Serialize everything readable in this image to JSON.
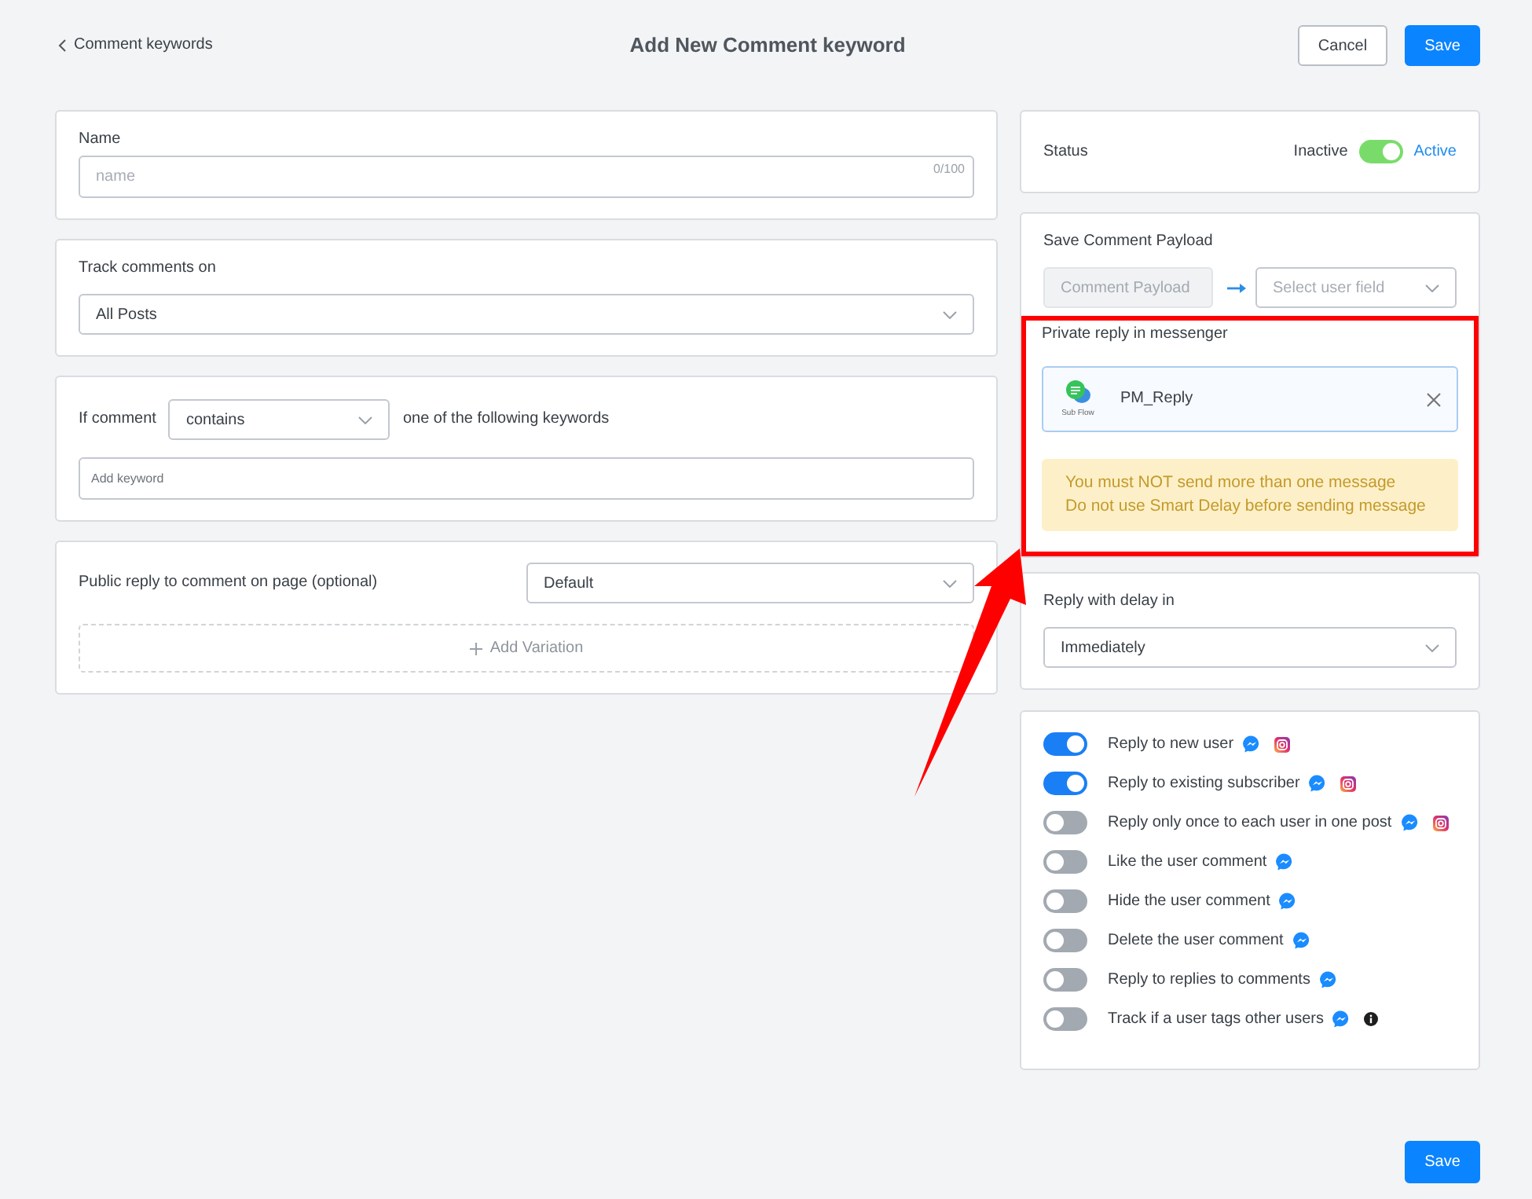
{
  "header": {
    "back_link": "Comment keywords",
    "title": "Add New Comment keyword",
    "buttons": [
      {
        "label": "Cancel",
        "kind": "secondary"
      },
      {
        "label": "Save",
        "kind": "primary"
      }
    ]
  },
  "name_card": {
    "label": "Name",
    "placeholder": "name",
    "counter": "0/100"
  },
  "track_card": {
    "label": "Track comments on",
    "value": "All Posts"
  },
  "keyword_card": {
    "prefix": "If comment",
    "match_value": "contains",
    "suffix": "one of the following keywords",
    "placeholder": "Add keyword"
  },
  "public_reply_card": {
    "label": "Public reply to comment on page (optional)",
    "value": "Default",
    "add_button": "Add Variation"
  },
  "status_card": {
    "label": "Status",
    "off_label": "Inactive",
    "on_label": "Active",
    "on": true
  },
  "payload_card": {
    "label": "Save Comment Payload",
    "source": {
      "placeholder": "Comment Payload",
      "disabled": true
    },
    "target": {
      "placeholder": "Select user field"
    },
    "private_reply": {
      "highlighted": true,
      "label": "Private reply in messenger",
      "flow": {
        "badge": "Sub Flow",
        "name": "PM_Reply"
      },
      "warnings": [
        "You must NOT send more than one message",
        "Do not use Smart Delay before sending message"
      ]
    }
  },
  "delay_card": {
    "label": "Reply with delay in",
    "value": "Immediately"
  },
  "options": [
    {
      "label": "Reply to new user",
      "on": true,
      "icons": [
        {
          "kind": "messenger"
        },
        {
          "kind": "instagram"
        }
      ]
    },
    {
      "label": "Reply to existing subscriber",
      "on": true,
      "icons": [
        {
          "kind": "messenger"
        },
        {
          "kind": "instagram"
        }
      ]
    },
    {
      "label": "Reply only once to each user in one post",
      "on": false,
      "icons": [
        {
          "kind": "messenger"
        },
        {
          "kind": "instagram"
        }
      ]
    },
    {
      "label": "Like the user comment",
      "on": false,
      "icons": [
        {
          "kind": "messenger"
        }
      ]
    },
    {
      "label": "Hide the user comment",
      "on": false,
      "icons": [
        {
          "kind": "messenger"
        }
      ]
    },
    {
      "label": "Delete the user comment",
      "on": false,
      "icons": [
        {
          "kind": "messenger"
        }
      ]
    },
    {
      "label": "Reply to replies to comments",
      "on": false,
      "icons": [
        {
          "kind": "messenger"
        }
      ]
    },
    {
      "label": "Track if a user tags other users",
      "on": false,
      "icons": [
        {
          "kind": "messenger"
        },
        {
          "kind": "info"
        }
      ]
    }
  ],
  "footer": {
    "buttons": [
      {
        "label": "Save",
        "kind": "primary"
      }
    ]
  }
}
